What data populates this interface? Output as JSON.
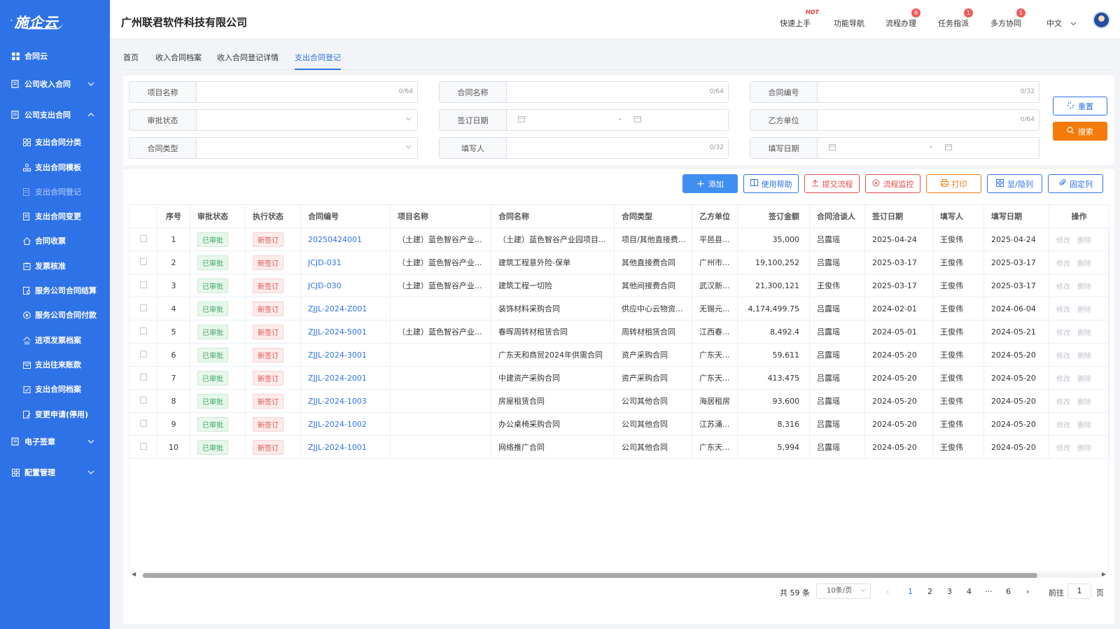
{
  "brand": {
    "logo": "施企云"
  },
  "header": {
    "company": "广州联君软件科技有限公司",
    "quick_start": "快速上手",
    "hot": "HOT",
    "func_nav": "功能导航",
    "flow": "流程办理",
    "flow_badge": "8",
    "task": "任务指派",
    "task_badge": "1",
    "collab": "多方协同",
    "collab_badge": "1",
    "lang": "中文"
  },
  "sidebar": {
    "home": "合同云",
    "income": "公司收入合同",
    "expense": "公司支出合同",
    "subs": [
      "支出合同分类",
      "支出合同模板",
      "支出合同登记",
      "支出合同变更",
      "合同收票",
      "发票核准",
      "服务公司合同结算",
      "服务公司合同付款",
      "进项发票档案",
      "支出往来账款",
      "支出合同档案",
      "变更申请(停用)"
    ],
    "esign": "电子签章",
    "config": "配置管理"
  },
  "tabs": [
    "首页",
    "收入合同档案",
    "收入合同登记详情",
    "支出合同登记"
  ],
  "filters": {
    "project_name": "项目名称",
    "contract_name": "合同名称",
    "contract_no": "合同编号",
    "approval_status": "审批状态",
    "sign_date": "签订日期",
    "party_b": "乙方单位",
    "contract_type": "合同类型",
    "filler": "填写人",
    "fill_date": "填写日期",
    "count64": "0/64",
    "count32": "0/32",
    "dash": "-"
  },
  "buttons": {
    "reset": "重置",
    "search": "搜索",
    "add": "添加",
    "help": "使用帮助",
    "submit_flow": "提交流程",
    "monitor": "流程监控",
    "print": "打印",
    "show_hide": "显/隐列",
    "fix_col": "固定列"
  },
  "table": {
    "headers": [
      "序号",
      "审批状态",
      "执行状态",
      "合同编号",
      "项目名称",
      "合同名称",
      "合同类型",
      "乙方单位",
      "签订金额",
      "合同洽谈人",
      "签订日期",
      "填写人",
      "填写日期",
      "操作"
    ],
    "op_edit": "修改",
    "op_delete": "删除",
    "rows": [
      [
        "1",
        "已审批",
        "新签订",
        "20250424001",
        "（土建）蓝色智谷产业...",
        "（土建）蓝色智谷产业园项目...",
        "项目/其他直接费...",
        "平邑县...",
        "35,000",
        "吕露瑶",
        "2025-04-24",
        "王俊伟",
        "2025-04-24"
      ],
      [
        "2",
        "已审批",
        "新签订",
        "JCJD-031",
        "（土建）蓝色智谷产业...",
        "建筑工程意外险-保单",
        "其他直接费合同",
        "广州市...",
        "19,100,252",
        "吕露瑶",
        "2025-03-17",
        "王俊伟",
        "2025-03-17"
      ],
      [
        "3",
        "已审批",
        "新签订",
        "JCJD-030",
        "（土建）蓝色智谷产业...",
        "建筑工程一切险",
        "其他间接费合同",
        "武汉新...",
        "21,300,121",
        "王俊伟",
        "2025-03-17",
        "王俊伟",
        "2025-03-17"
      ],
      [
        "4",
        "已审批",
        "新签订",
        "ZJJL-2024-Z001",
        "",
        "装饰材料采购合同",
        "供应中心云物资...",
        "无锡元...",
        "4,174,499.75",
        "吕露瑶",
        "2024-02-01",
        "王俊伟",
        "2024-06-04"
      ],
      [
        "5",
        "已审批",
        "新签订",
        "ZJJL-2024-5001",
        "（土建）蓝色智谷产业...",
        "春晖周转材租赁合同",
        "周转材租赁合同",
        "江西春...",
        "8,492.4",
        "吕露瑶",
        "2024-05-01",
        "王俊伟",
        "2024-05-21"
      ],
      [
        "6",
        "已审批",
        "新签订",
        "ZJJL-2024-3001",
        "",
        "广东天和商贸2024年供需合同",
        "资产采购合同",
        "广东天...",
        "59,611",
        "吕露瑶",
        "2024-05-20",
        "王俊伟",
        "2024-05-20"
      ],
      [
        "7",
        "已审批",
        "新签订",
        "ZJJL-2024-2001",
        "",
        "中建资产采购合同",
        "资产采购合同",
        "广东天...",
        "413,475",
        "吕露瑶",
        "2024-05-20",
        "王俊伟",
        "2024-05-20"
      ],
      [
        "8",
        "已审批",
        "新签订",
        "ZJJL-2024-1003",
        "",
        "房屋租赁合同",
        "公司其他合同",
        "海居租房",
        "93,600",
        "吕露瑶",
        "2024-05-20",
        "王俊伟",
        "2024-05-20"
      ],
      [
        "9",
        "已审批",
        "新签订",
        "ZJJL-2024-1002",
        "",
        "办公桌椅采购合同",
        "公司其他合同",
        "江苏涌...",
        "8,316",
        "吕露瑶",
        "2024-05-20",
        "王俊伟",
        "2024-05-20"
      ],
      [
        "10",
        "已审批",
        "新签订",
        "ZJJL-2024-1001",
        "",
        "网络推广合同",
        "公司其他合同",
        "广东天...",
        "5,994",
        "吕露瑶",
        "2024-05-20",
        "王俊伟",
        "2024-05-20"
      ]
    ]
  },
  "pagination": {
    "total": "共 59 条",
    "page_size": "10条/页",
    "pages": [
      "1",
      "2",
      "3",
      "4",
      "···",
      "6"
    ],
    "goto": "前往",
    "goto_value": "1",
    "page_unit": "页"
  }
}
